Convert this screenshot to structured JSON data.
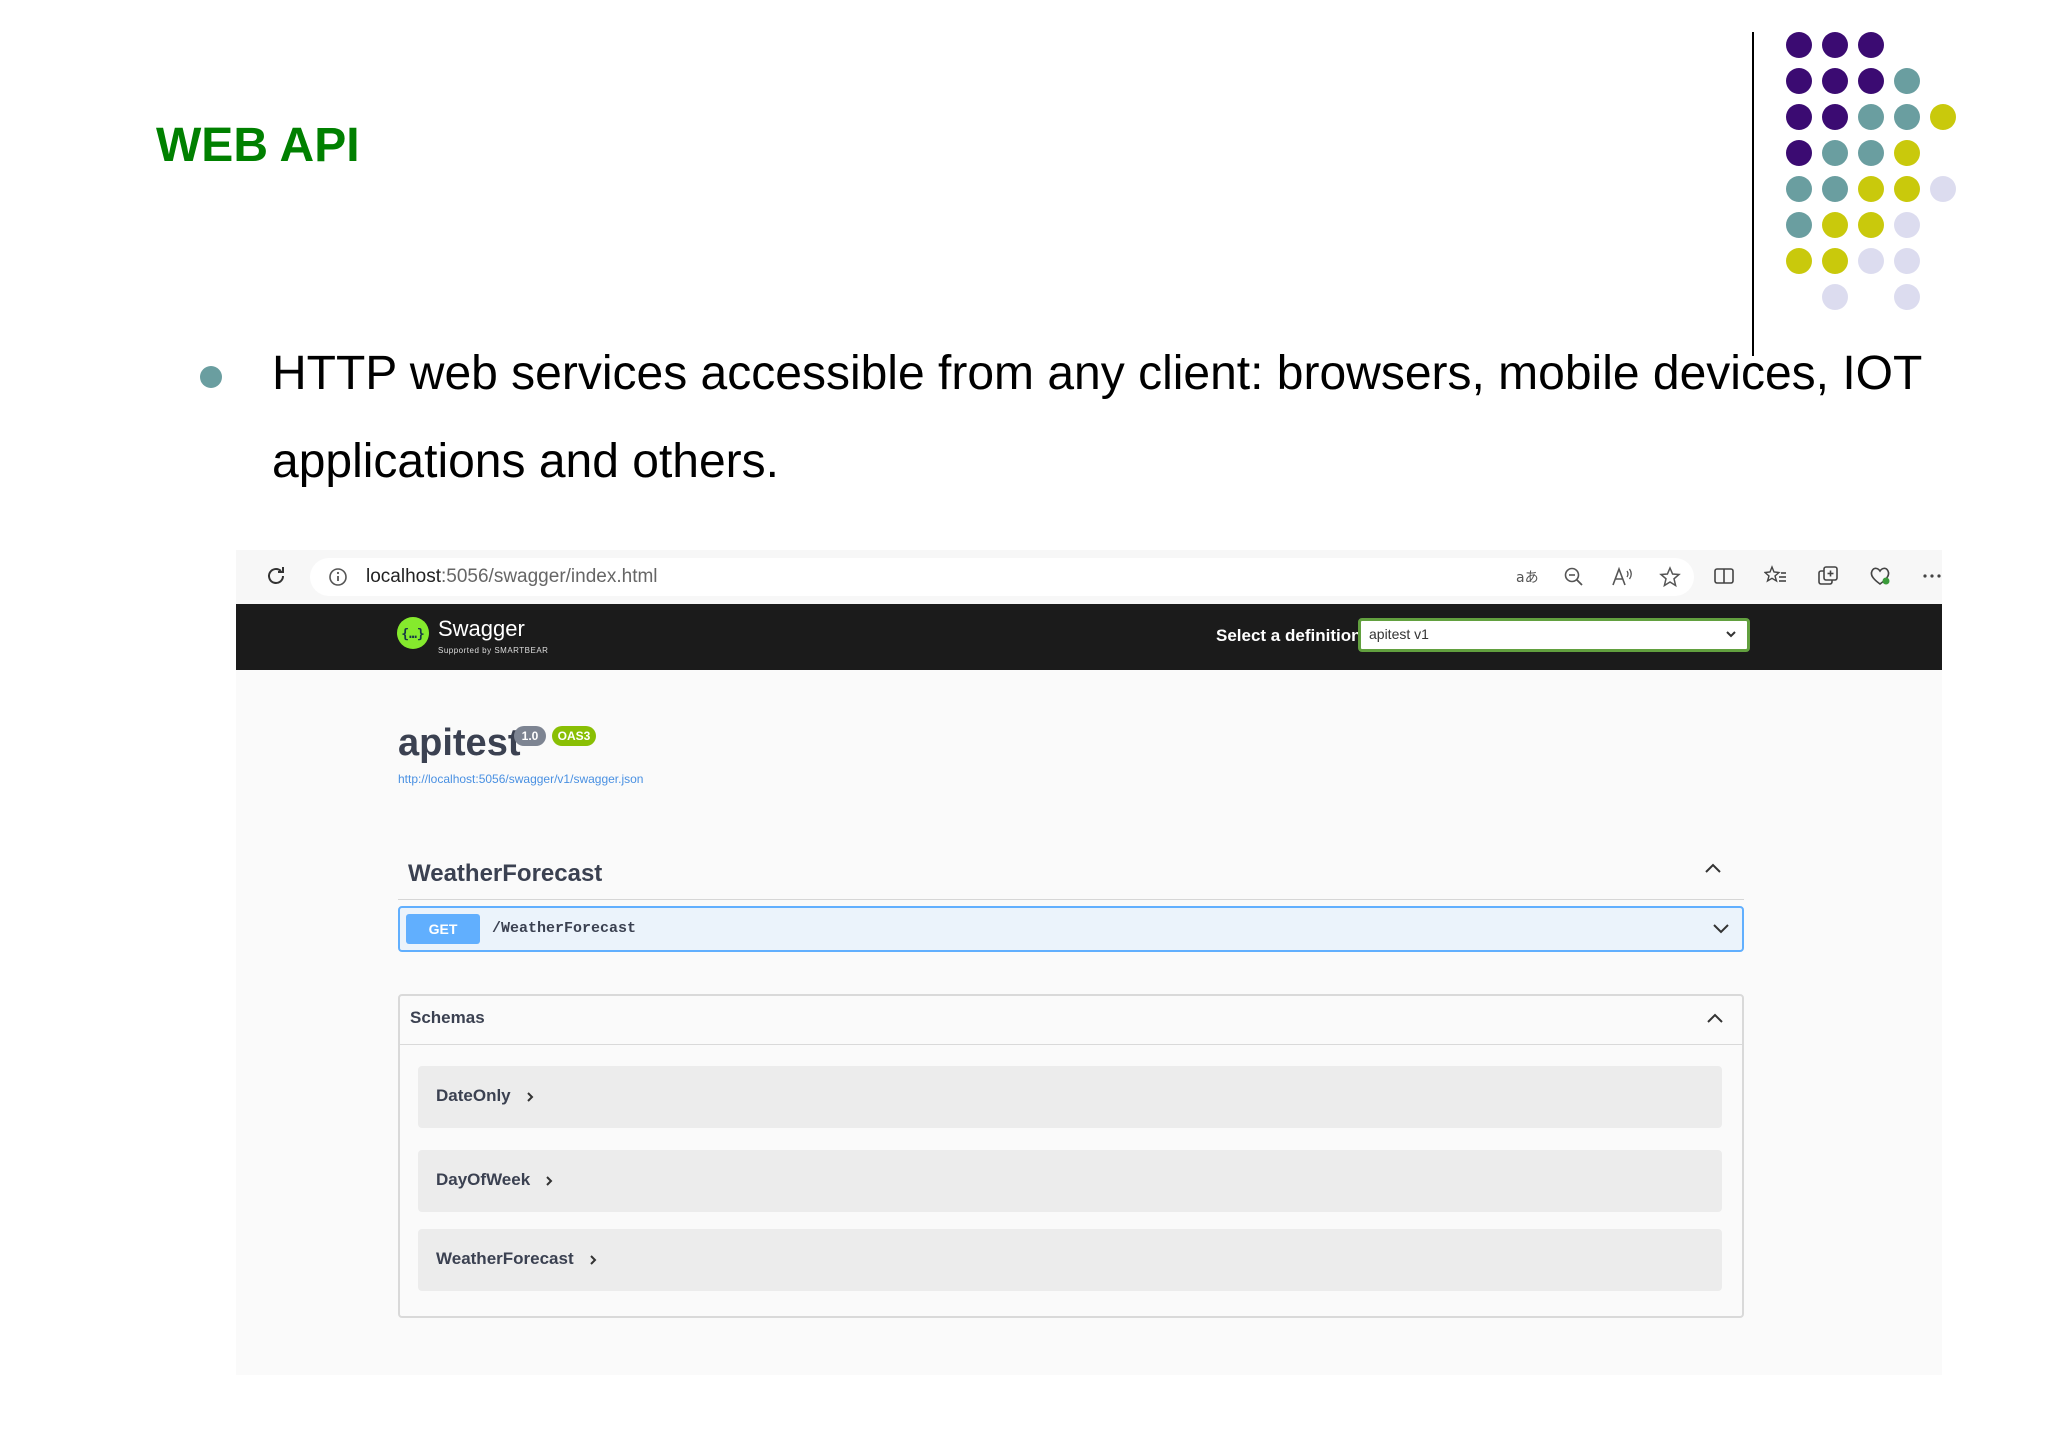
{
  "slide": {
    "title": "WEB API",
    "bullet": "HTTP web services accessible from any client: browsers, mobile devices, IOT applications and others."
  },
  "colors": {
    "title_green": "#008000",
    "bullet_teal": "#6a9ea0",
    "purple": "#3b0b72",
    "teal": "#6a9ea0",
    "lime": "#c9c90c",
    "lavender": "#dcdcef",
    "swagger_green": "#85ea2d",
    "get_blue": "#61affe"
  },
  "browser": {
    "url_host": "localhost",
    "url_path": ":5056/swagger/index.html",
    "icons": [
      "reload-icon",
      "info-icon",
      "translate-icon",
      "zoom-out-icon",
      "read-aloud-icon",
      "favorite-star-icon",
      "split-screen-icon",
      "favorites-list-icon",
      "collections-icon",
      "browser-essentials-icon",
      "more-icon"
    ]
  },
  "swagger": {
    "brand": "Swagger",
    "brand_sub": "Supported by SMARTBEAR",
    "select_label": "Select a definition",
    "select_value": "apitest v1",
    "api_title": "apitest",
    "version_badge": "1.0",
    "oas_badge": "OAS3",
    "spec_link": "http://localhost:5056/swagger/v1/swagger.json",
    "tag": "WeatherForecast",
    "operation": {
      "method": "GET",
      "path": "/WeatherForecast"
    },
    "schemas_title": "Schemas",
    "schemas": [
      "DateOnly",
      "DayOfWeek",
      "WeatherForecast"
    ]
  }
}
